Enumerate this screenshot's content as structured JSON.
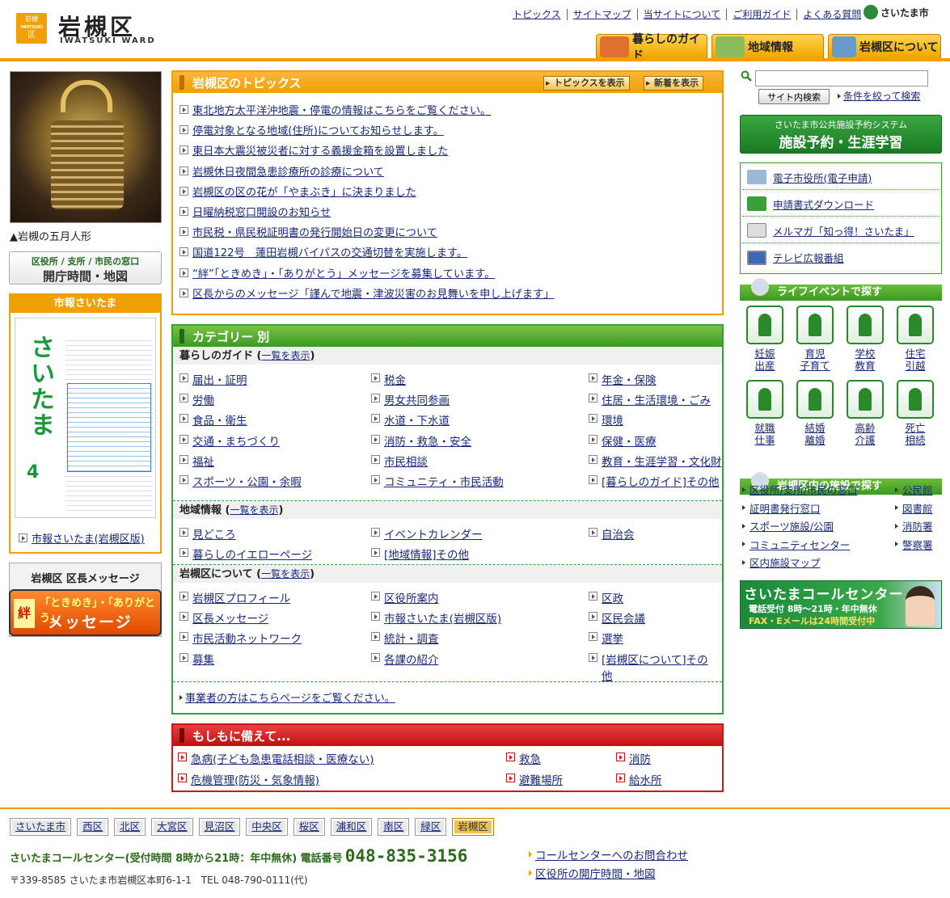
{
  "header": {
    "logo_small_top": "岩槻",
    "logo_small_bottom": "IWATSUKI",
    "logo_small_corner": "区",
    "title": "岩槻区",
    "subtitle": "IWATSUKI WARD",
    "top_links": [
      "トピックス",
      "サイトマップ",
      "当サイトについて",
      "ご利用ガイド",
      "よくある質問"
    ],
    "city_logo": "さいたま市",
    "nav_tabs": [
      "暮らしのガイド",
      "地域情報",
      "岩槻区について"
    ]
  },
  "left": {
    "photo_caption": "▲岩槻の五月人形",
    "hours_small": "区役所 / 支所 / 市民の窓口",
    "hours_big": "開庁時間・地図",
    "shiho_title": "市報さいたま",
    "shiho_cover_title": "さいたま",
    "shiho_cover_number": "4",
    "shiho_link": "市報さいたま(岩槻区版)",
    "message_title": "岩槻区 区長メッセージ",
    "message_kanji": "絆",
    "message_line1": "「ときめき」・「ありがとう」",
    "message_line2": "メッセージ"
  },
  "topics": {
    "title": "岩槻区のトピックス",
    "btn_show": "トピックスを表示",
    "btn_new": "新着を表示",
    "items": [
      "東北地方太平洋沖地震・停電の情報はこちらをご覧ください。",
      "停電対象となる地域(住所)についてお知らせします。",
      "東日本大震災被災者に対する義援金箱を設置しました",
      "岩槻休日夜間急患診療所の診療について",
      "岩槻区の区の花が「やまぶき」に決まりました",
      "日曜納税窓口開設のお知らせ",
      "市民税・県民税証明書の発行開始日の変更について",
      "国道122号　蓮田岩槻バイパスの交通切替を実施します。",
      "“絆”「ときめき」・「ありがとう」メッセージを募集しています。",
      "区長からのメッセージ「謹んで地震・津波災害のお見舞いを申し上げます」"
    ]
  },
  "categories": {
    "title": "カテゴリー 別",
    "list_link": "一覧を表示",
    "sec1_title": "暮らしのガイド",
    "sec1_items": [
      "届出・証明",
      "税金",
      "年金・保険",
      "労働",
      "男女共同参画",
      "住居・生活環境・ごみ",
      "食品・衛生",
      "水道・下水道",
      "環境",
      "交通・まちづくり",
      "消防・救急・安全",
      "保健・医療",
      "福祉",
      "市民相談",
      "教育・生涯学習・文化財",
      "スポーツ・公園・余暇",
      "コミュニティ・市民活動",
      "[暮らしのガイド]その他"
    ],
    "sec2_title": "地域情報",
    "sec2_items": [
      "見どころ",
      "イベントカレンダー",
      "自治会",
      "暮らしのイエローページ",
      "[地域情報]その他"
    ],
    "sec3_title": "岩槻区について",
    "sec3_items": [
      "岩槻区プロフィール",
      "区役所案内",
      "区政",
      "区長メッセージ",
      "市報さいたま(岩槻区版)",
      "区民会議",
      "市民活動ネットワーク",
      "統計・調査",
      "選挙",
      "募集",
      "各課の紹介",
      "[岩槻区について]その他"
    ],
    "business_link": "事業者の方はこちらページをご覧ください。"
  },
  "emergency": {
    "title": "もしもに備えて...",
    "items": [
      "急病(子ども急患電話相談・医療ない)",
      "救急",
      "消防",
      "危機管理(防災・気象情報)",
      "避難場所",
      "給水所"
    ]
  },
  "right": {
    "search_placeholder": "",
    "search_button": "サイト内検索",
    "advanced_link": "条件を絞って検索",
    "facility_small": "さいたま市公共施設予約システム",
    "facility_big": "施設予約・生涯学習",
    "services": [
      "電子市役所(電子申請)",
      "申請書式ダウンロード",
      "メルマガ「知っ得！さいたま」",
      "テレビ広報番組"
    ],
    "life_title": "ライフイベントで探す",
    "life": [
      [
        "妊娠",
        "出産"
      ],
      [
        "育児",
        "子育て"
      ],
      [
        "学校",
        "教育"
      ],
      [
        "住宅",
        "引越"
      ],
      [
        "就職",
        "仕事"
      ],
      [
        "結婚",
        "離婚"
      ],
      [
        "高齢",
        "介護"
      ],
      [
        "死亡",
        "相続"
      ]
    ],
    "fac_title": "岩槻区内の施設で探す",
    "fac_left": [
      "区役所/支所/市民の窓口",
      "証明書発行窓口",
      "スポーツ施設/公園",
      "コミュニティセンター",
      "区内施設マップ"
    ],
    "fac_right": [
      "公民館",
      "図書館",
      "消防署",
      "警察署"
    ],
    "callcenter_title": "さいたまコールセンター",
    "callcenter_line1": "電話受付 8時〜21時・年中無休",
    "callcenter_line2": "FAX・Eメールは24時間受付中"
  },
  "footer": {
    "wards": [
      "さいたま市",
      "西区",
      "北区",
      "大宮区",
      "見沼区",
      "中央区",
      "桜区",
      "浦和区",
      "南区",
      "緑区",
      "岩槻区"
    ],
    "callcenter_text": "さいたまコールセンター(受付時間 8時から21時：年中無休) 電話番号",
    "callcenter_tel": "048-835-3156",
    "address": "〒339-8585 さいたま市岩槻区本町6-1-1　TEL 048-790-0111(代)",
    "link1": "コールセンターへのお問合わせ",
    "link2": "区役所の開庁時間・地図"
  },
  "colors": {
    "accent": "#f0a000",
    "green": "#3aa03a",
    "red": "#c81818",
    "link": "#1a2a7a"
  }
}
